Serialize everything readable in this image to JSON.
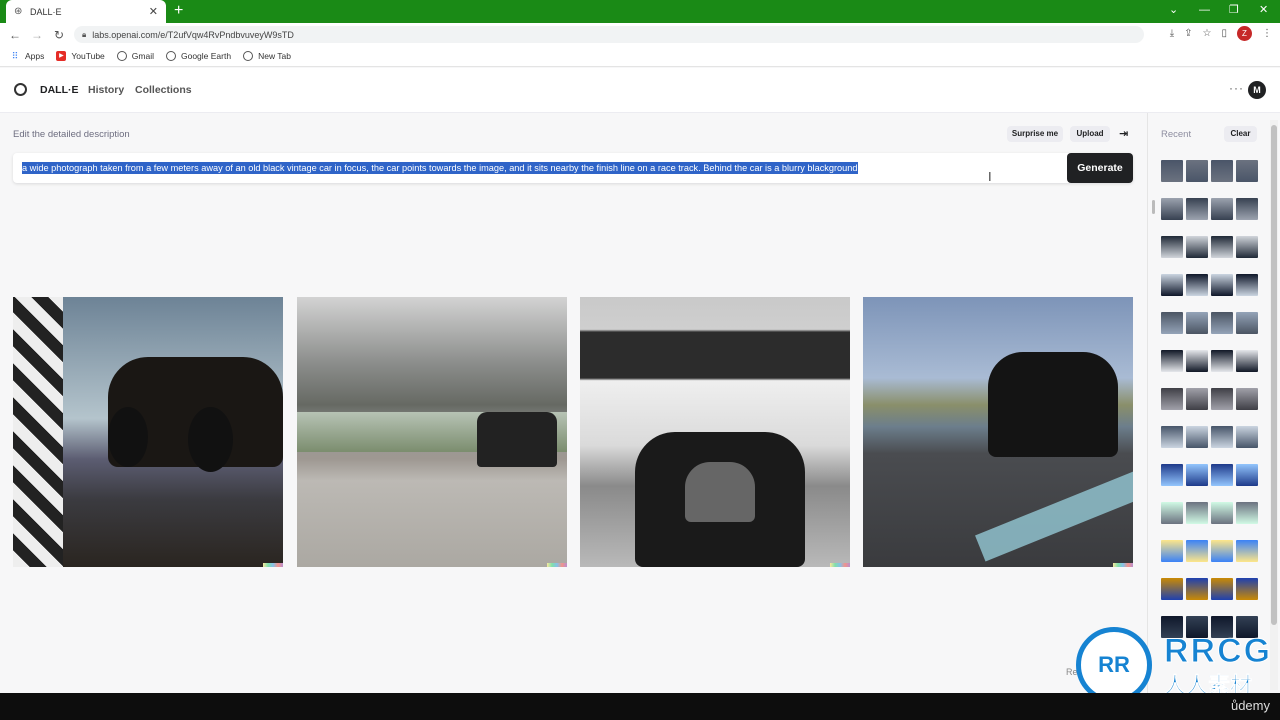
{
  "browser": {
    "tab_title": "DALL·E",
    "tab_close": "✕",
    "new_tab": "+",
    "url": "labs.openai.com/e/T2ufVqw4RvPndbvuveyW9sTD",
    "bookmarks": [
      {
        "label": "Apps",
        "icon": "apps-grid-icon"
      },
      {
        "label": "YouTube",
        "icon": "youtube-icon"
      },
      {
        "label": "Gmail",
        "icon": "globe-icon"
      },
      {
        "label": "Google Earth",
        "icon": "globe-icon"
      },
      {
        "label": "New Tab",
        "icon": "globe-icon"
      }
    ],
    "profile_initial": "Z",
    "frame_color": "#1a8a16"
  },
  "app": {
    "brand": "DALL·E",
    "nav": {
      "history": "History",
      "collections": "Collections"
    },
    "user_initial": "M",
    "more": "···"
  },
  "editor": {
    "label": "Edit the detailed description",
    "surprise_label": "Surprise me",
    "upload_label": "Upload",
    "prompt": "a wide photograph taken from a few meters away of an old black vintage car in focus, the car points towards the image, and it sits nearby the finish line on a race track. Behind the car is a blurry blackground",
    "generate_label": "Generate"
  },
  "results": {
    "images": [
      {
        "icon": "generated-image",
        "description_name": "vintage-car-checkered-flag"
      },
      {
        "icon": "generated-image",
        "description_name": "vintage-car-blurry-track"
      },
      {
        "icon": "generated-image",
        "description_name": "vintage-racecar-front"
      },
      {
        "icon": "generated-image",
        "description_name": "vintage-car-rear-ribbon"
      }
    ],
    "partial_text": "Re"
  },
  "sidebar": {
    "recent_label": "Recent",
    "clear_label": "Clear",
    "thumb_rows": 13
  },
  "watermark": {
    "logo_text": "RR",
    "brand": "RRCG",
    "subtitle": "人人素材",
    "udemy": "ůdemy"
  },
  "colors": {
    "generate_bg": "#202123",
    "selection": "#2f64c8",
    "watermark_blue": "#1683d2"
  }
}
